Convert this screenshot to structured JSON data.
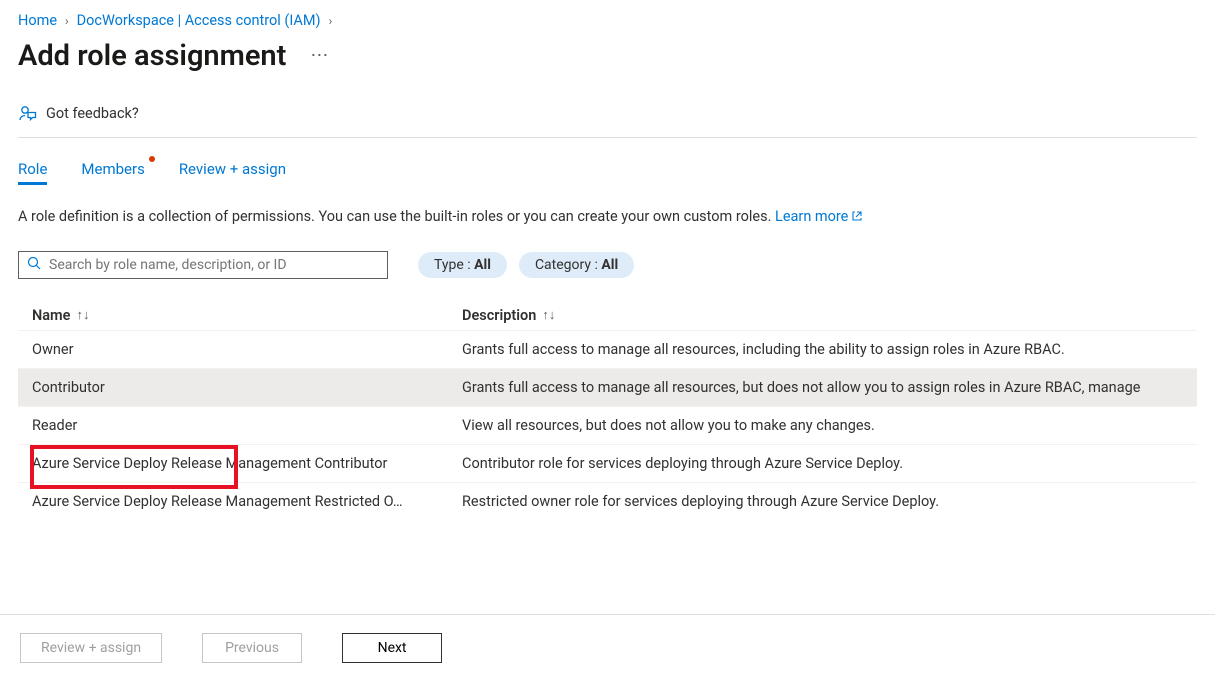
{
  "breadcrumb": {
    "home": "Home",
    "workspace": "DocWorkspace | Access control (IAM)"
  },
  "page_title": "Add role assignment",
  "feedback": "Got feedback?",
  "tabs": {
    "role": "Role",
    "members": "Members",
    "review": "Review + assign"
  },
  "description": {
    "text": "A role definition is a collection of permissions. You can use the built-in roles or you can create your own custom roles. ",
    "learn_more": "Learn more"
  },
  "search": {
    "placeholder": "Search by role name, description, or ID"
  },
  "filters": {
    "type_label": "Type : ",
    "type_value": "All",
    "category_label": "Category : ",
    "category_value": "All"
  },
  "table": {
    "col_name": "Name",
    "col_desc": "Description",
    "rows": [
      {
        "name": "Owner",
        "desc": "Grants full access to manage all resources, including the ability to assign roles in Azure RBAC."
      },
      {
        "name": "Contributor",
        "desc": "Grants full access to manage all resources, but does not allow you to assign roles in Azure RBAC, manage"
      },
      {
        "name": "Reader",
        "desc": "View all resources, but does not allow you to make any changes."
      },
      {
        "name": "Azure Service Deploy Release Management Contributor",
        "desc": "Contributor role for services deploying through Azure Service Deploy."
      },
      {
        "name": "Azure Service Deploy Release Management Restricted O…",
        "desc": "Restricted owner role for services deploying through Azure Service Deploy."
      }
    ]
  },
  "footer": {
    "review": "Review + assign",
    "previous": "Previous",
    "next": "Next"
  }
}
